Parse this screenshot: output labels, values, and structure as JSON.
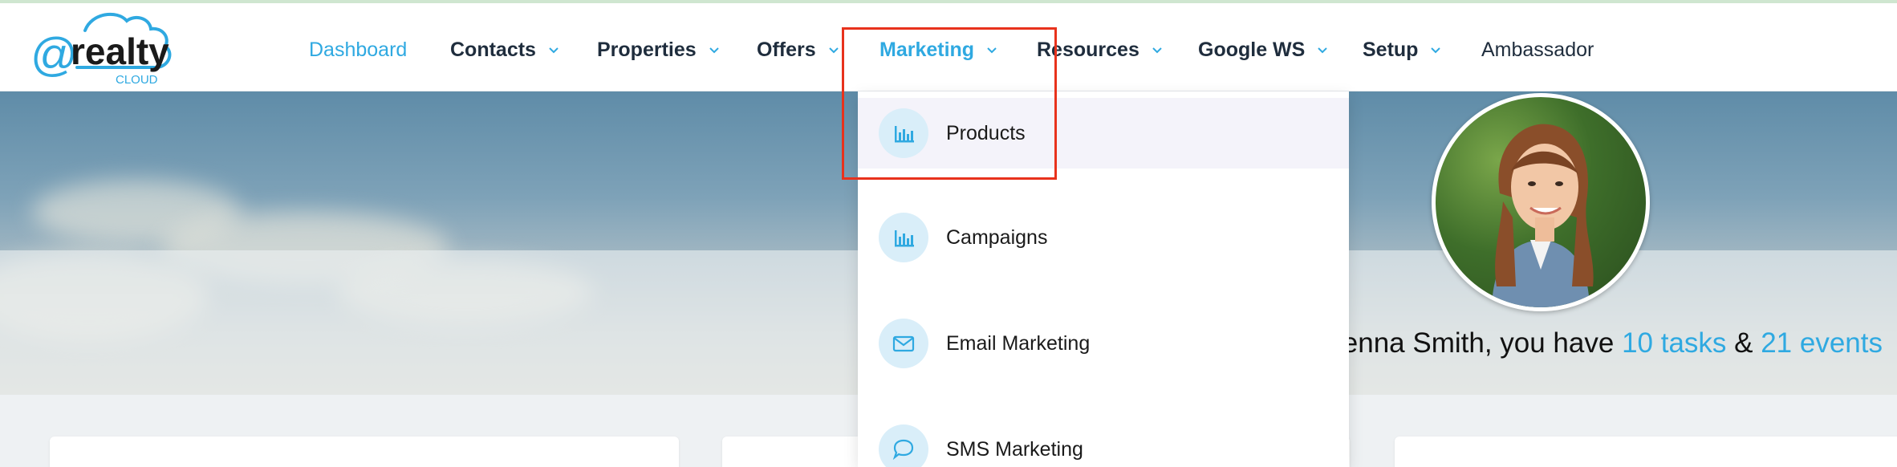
{
  "brand": {
    "logo_text_at": "@",
    "logo_text_main": "realty",
    "logo_text_sub": "CLOUD"
  },
  "nav": {
    "items": [
      {
        "label": "Dashboard",
        "active": true,
        "dropdown": false
      },
      {
        "label": "Contacts",
        "active": false,
        "dropdown": true
      },
      {
        "label": "Properties",
        "active": false,
        "dropdown": true
      },
      {
        "label": "Offers",
        "active": false,
        "dropdown": true
      },
      {
        "label": "Marketing",
        "active": true,
        "dropdown": true
      },
      {
        "label": "Resources",
        "active": false,
        "dropdown": true
      },
      {
        "label": "Google WS",
        "active": false,
        "dropdown": true
      },
      {
        "label": "Setup",
        "active": false,
        "dropdown": true
      },
      {
        "label": "Ambassador",
        "active": false,
        "dropdown": false
      }
    ]
  },
  "marketing_menu": {
    "items": [
      {
        "label": "Products",
        "icon": "bar-chart-icon",
        "highlighted": true
      },
      {
        "label": "Campaigns",
        "icon": "bar-chart-icon",
        "highlighted": false
      },
      {
        "label": "Email Marketing",
        "icon": "envelope-icon",
        "highlighted": false
      },
      {
        "label": "SMS Marketing",
        "icon": "chat-bubble-icon",
        "highlighted": false
      }
    ]
  },
  "greeting": {
    "prefix": "enna Smith, you have ",
    "tasks": "10 tasks",
    "amp": " & ",
    "events": "21 events"
  },
  "colors": {
    "accent": "#2fa9e1",
    "highlight_box": "#e8321c",
    "menu_hover": "#f4f3fa",
    "icon_circle": "#d9eef9"
  }
}
